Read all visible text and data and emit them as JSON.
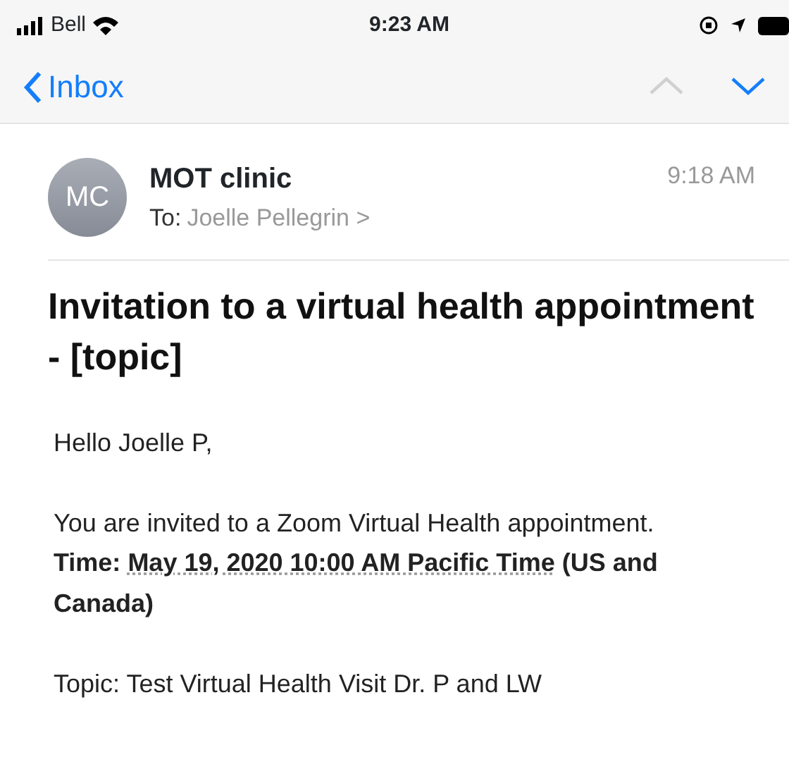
{
  "status_bar": {
    "carrier": "Bell",
    "time": "9:23 AM"
  },
  "nav": {
    "back_label": "Inbox",
    "previous": {
      "disabled": true
    },
    "next": {
      "disabled": false
    }
  },
  "message": {
    "avatar_initials": "MC",
    "sender": "MOT clinic",
    "to_label": "To:",
    "recipient": "Joelle Pellegrin >",
    "time": "9:18 AM",
    "subject": "Invitation to a virtual health appointment - [topic]",
    "body": [
      {
        "kind": "text",
        "text": "Hello Joelle P,"
      },
      {
        "kind": "text",
        "text": "You are invited to a Zoom Virtual Health appointment."
      },
      {
        "kind": "time",
        "before": "Time: ",
        "link": "May 19, 2020 10:00 AM Pacific Time",
        "after": " (US and Canada)"
      },
      {
        "kind": "text",
        "text": "Topic: Test Virtual Health Visit Dr. P and LW"
      }
    ]
  }
}
